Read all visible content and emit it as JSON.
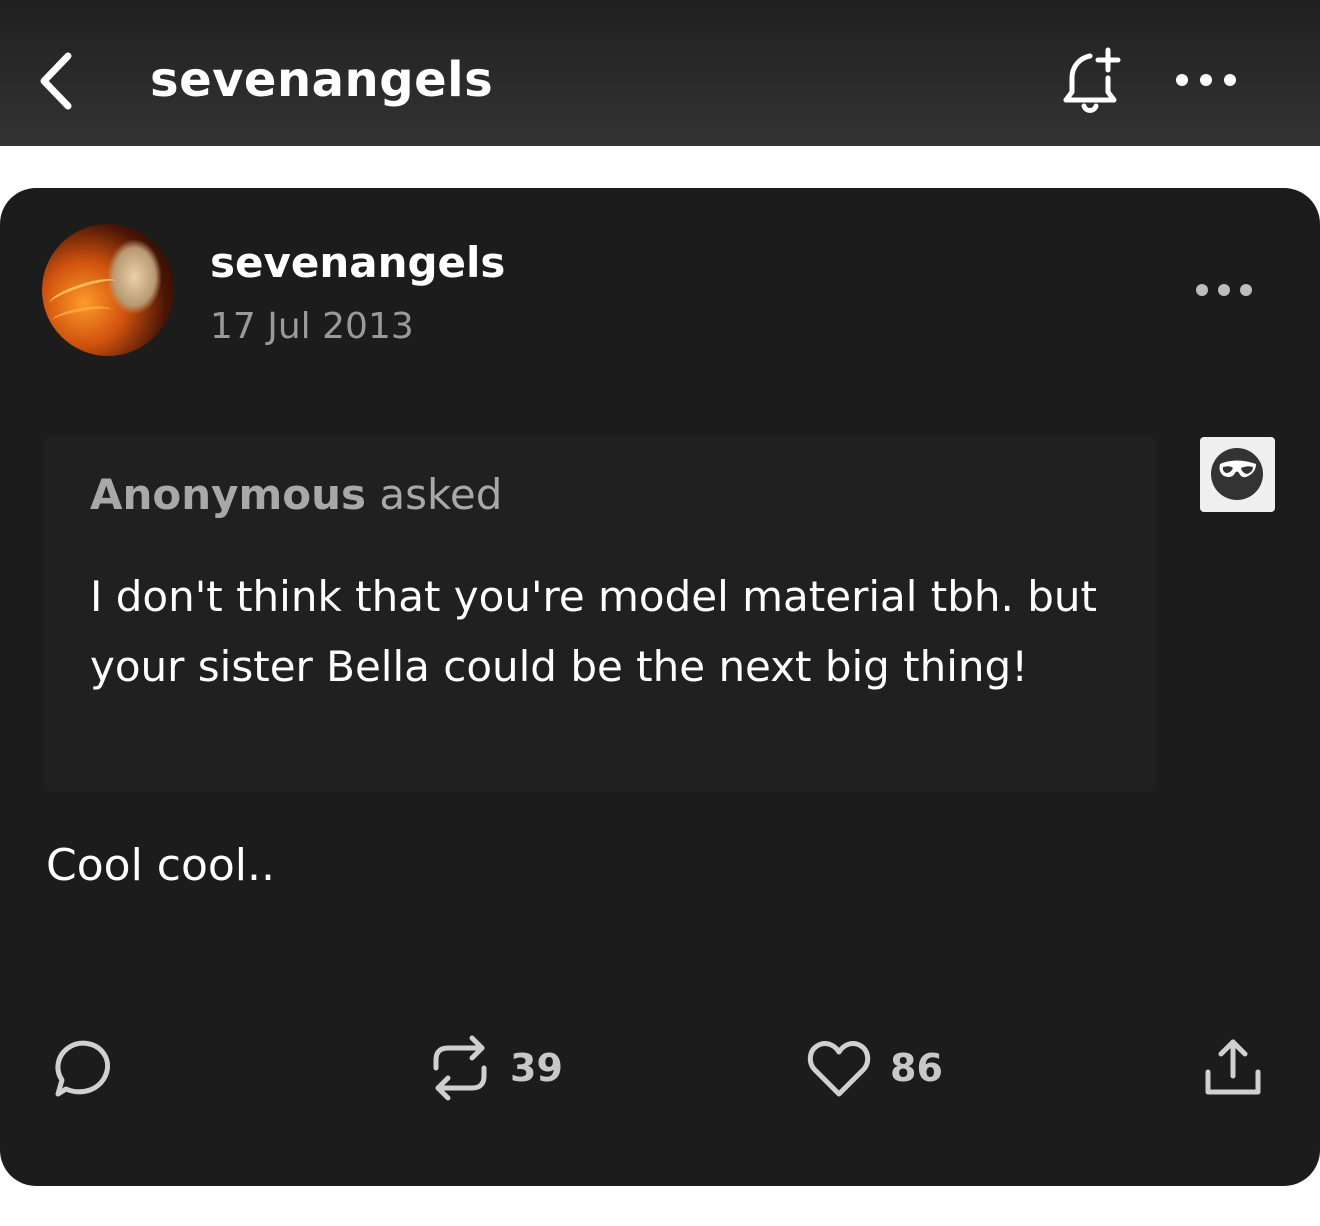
{
  "header": {
    "title": "sevenangels",
    "back_icon": "chevron-left-icon",
    "follow_icon": "bell-plus-icon",
    "more_icon": "more-horizontal-icon"
  },
  "post": {
    "author": "sevenangels",
    "date": "17 Jul 2013",
    "more_icon": "more-horizontal-icon",
    "ask": {
      "asker": "Anonymous",
      "verb": "asked",
      "question": "I don't think that you're model material tbh. but your sister Bella could be the next big thing!",
      "badge_icon": "anonymous-sunglasses-icon"
    },
    "answer": "Cool cool..",
    "actions": {
      "reply_icon": "comment-icon",
      "reblog_icon": "reblog-icon",
      "reblog_count": "39",
      "like_icon": "heart-icon",
      "like_count": "86",
      "share_icon": "share-icon"
    }
  },
  "colors": {
    "topbar": "#2a2a2a",
    "card": "#1c1c1c",
    "ask_box": "#202020",
    "secondary_text": "#9a9a9a"
  }
}
